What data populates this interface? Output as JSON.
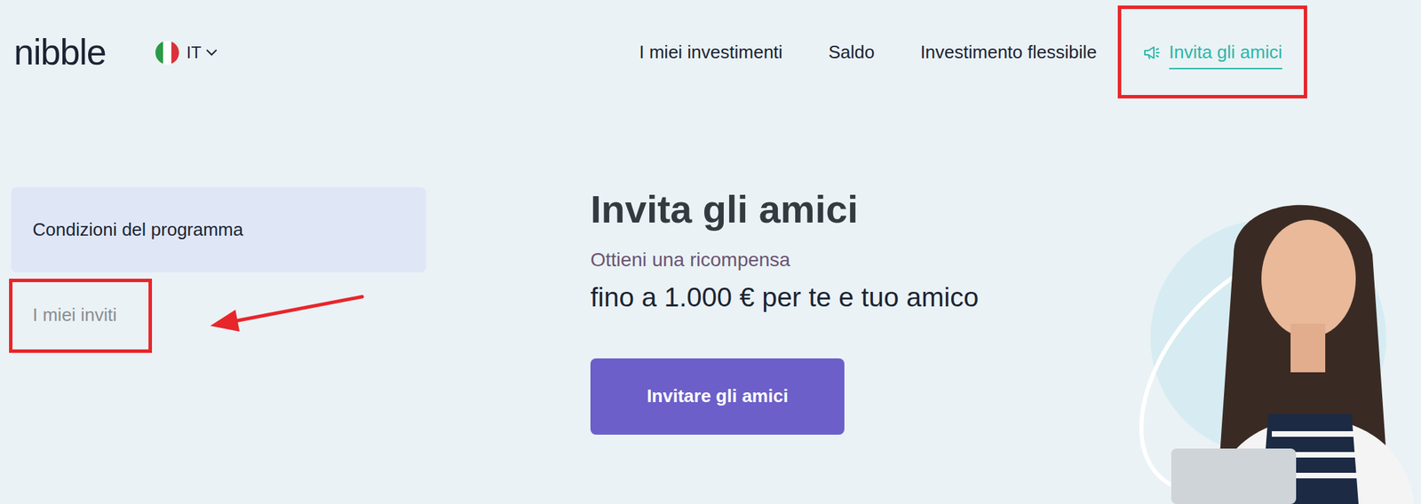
{
  "logo": "nibble",
  "language": {
    "code": "IT"
  },
  "nav": [
    {
      "label": "I miei investimenti",
      "selected": false,
      "highlighted": false
    },
    {
      "label": "Saldo",
      "selected": false,
      "highlighted": false
    },
    {
      "label": "Investimento flessibile",
      "selected": false,
      "highlighted": false
    },
    {
      "label": "Invita gli amici",
      "selected": true,
      "highlighted": true
    }
  ],
  "sidebar": {
    "items": [
      {
        "label": "Condizioni del programma",
        "selected": true,
        "highlighted": false,
        "pointed": false
      },
      {
        "label": "I miei inviti",
        "selected": false,
        "highlighted": true,
        "pointed": true
      }
    ]
  },
  "hero": {
    "title": "Invita gli amici",
    "subtitle": "Ottieni una ricompensa",
    "reward": "fino a 1.000 € per te e tuo amico",
    "button": "Invitare gli amici"
  }
}
